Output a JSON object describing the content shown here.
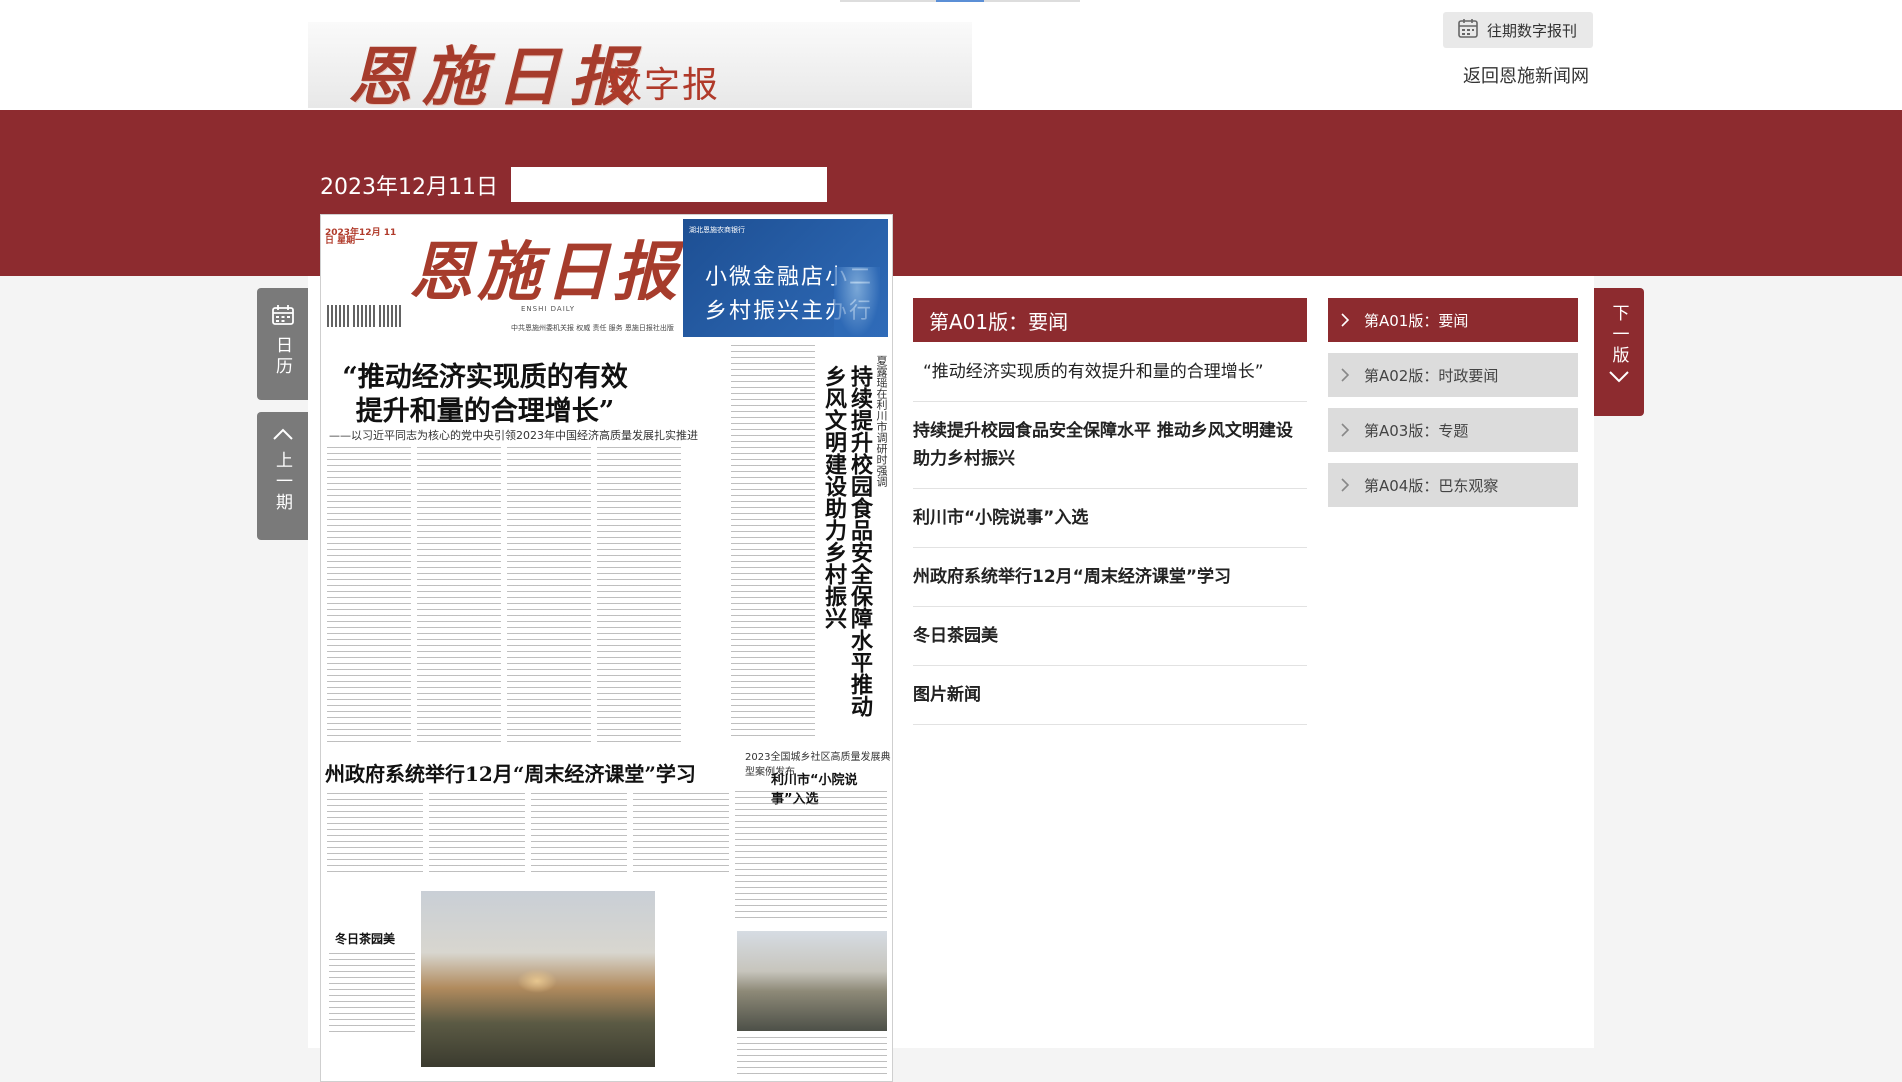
{
  "header": {
    "logo_main": "恩施日报",
    "logo_sub": "数字报",
    "past_issues_label": "往期数字报刊",
    "back_link_label": "返回恩施新闻网"
  },
  "issue": {
    "date": "2023年12月11日",
    "search_placeholder": ""
  },
  "side_tabs": {
    "calendar_label": "日历",
    "prev_label": "上一期",
    "next_label": "下一版"
  },
  "current_section": {
    "title": "第A01版：要闻"
  },
  "articles": [
    {
      "title": "“推动经济实现质的有效提升和量的合理增长”"
    },
    {
      "title": "持续提升校园食品安全保障水平 推动乡风文明建设助力乡村振兴"
    },
    {
      "title": "利川市“小院说事”入选"
    },
    {
      "title": "州政府系统举行12月“周末经济课堂”学习"
    },
    {
      "title": "冬日茶园美"
    },
    {
      "title": "图片新闻"
    }
  ],
  "pages": [
    {
      "label": "第A01版：要闻",
      "active": true
    },
    {
      "label": "第A02版：时政要闻",
      "active": false
    },
    {
      "label": "第A03版：专题",
      "active": false
    },
    {
      "label": "第A04版：巴东观察",
      "active": false
    }
  ],
  "newspaper": {
    "masthead_title": "恩施日报",
    "masthead_en": "ENSHI DAILY",
    "masthead_date_small": "2023年12月 11日 星期一",
    "masthead_slogan": "中共恩施州委机关报    权威 责任 服务    恩施日报社出版",
    "ad_bank": "湖北恩施农商银行",
    "ad_line1": "小微金融店小二",
    "ad_line2": "乡村振兴主办行",
    "headline1": "“推动经济实现质的有效提升和量的合理增长”",
    "subheadline1": "——以习近平同志为核心的党中央引领2023年中国经济高质量发展扎实推进",
    "vertical_headline": "持续提升校园食品安全保障水平推动乡风文明建设助力乡村振兴",
    "vertical_sub": "夏露瑶在利川市调研时强调",
    "headline2": "州政府系统举行12月“周末经济课堂”学习",
    "small_kicker": "2023全国城乡社区高质量发展典型案例发布",
    "headline3": "利川市“小院说事”入选",
    "photo_caption": "冬日茶园美"
  },
  "colors": {
    "brand_red": "#8d2b2f",
    "logo_red": "#a63c2c",
    "tab_gray": "#7a7a7a",
    "inactive_page": "#dcdcdc"
  }
}
